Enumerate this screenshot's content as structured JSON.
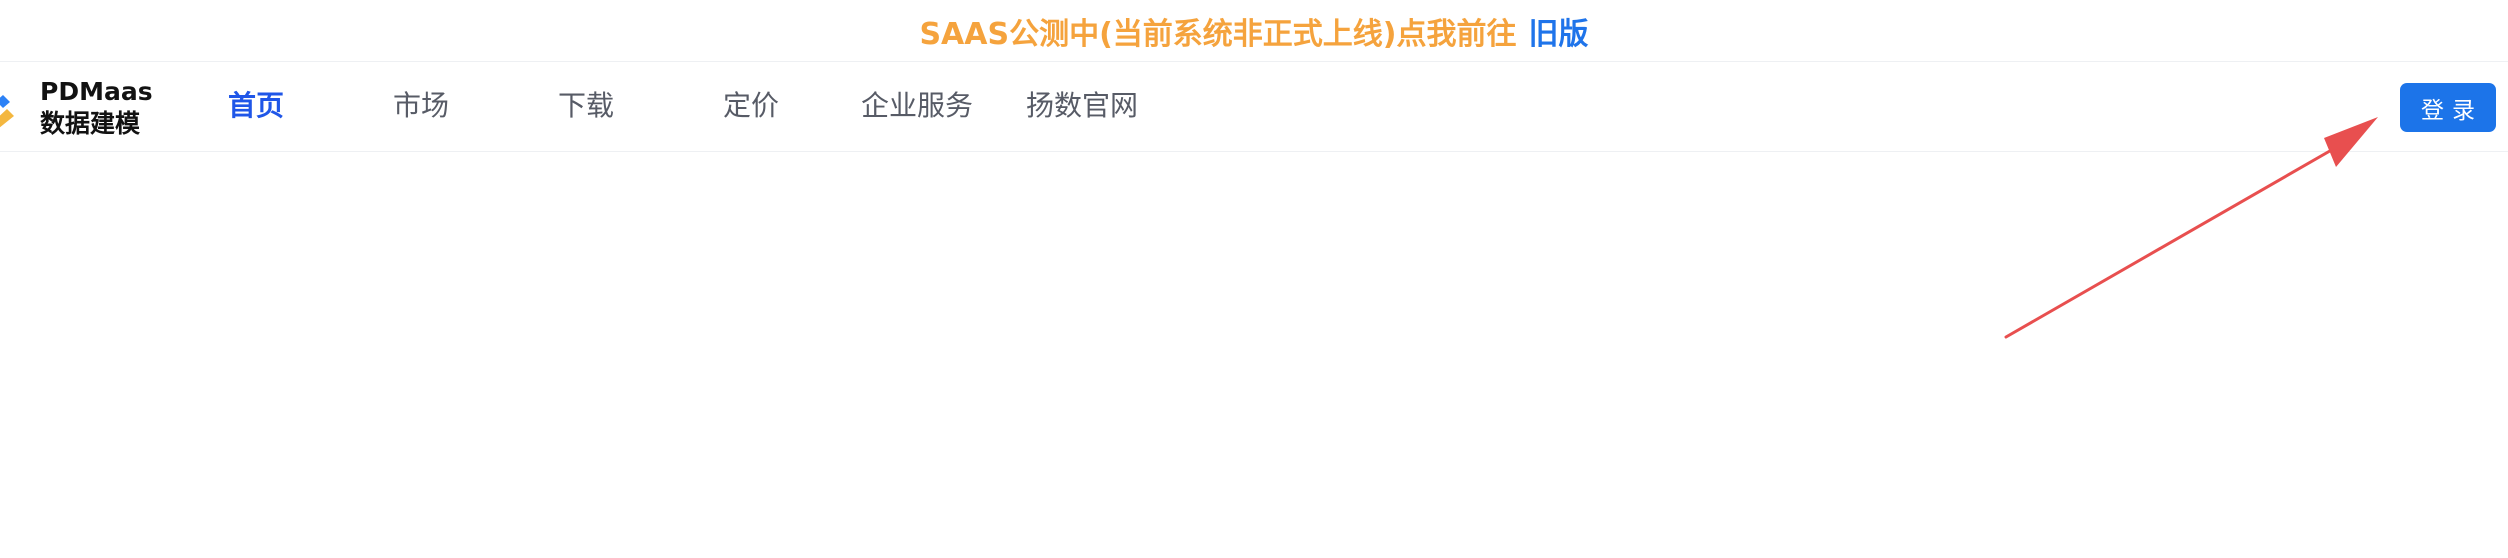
{
  "banner": {
    "text": "SAAS公测中(当前系统非正式上线)点我前往",
    "link_label": "旧版"
  },
  "logo": {
    "line1": "PDMaas",
    "line2": "数据建模"
  },
  "nav": {
    "items": [
      {
        "label": "首页",
        "active": true
      },
      {
        "label": "市场",
        "active": false
      },
      {
        "label": "下载",
        "active": false
      },
      {
        "label": "定价",
        "active": false
      },
      {
        "label": "企业服务",
        "active": false
      },
      {
        "label": "扬数官网",
        "active": false
      }
    ]
  },
  "login": {
    "label": "登录"
  },
  "colors": {
    "banner_text": "#f5a33d",
    "banner_link": "#1f74ea",
    "nav_active": "#1f56e8",
    "nav_text": "#575b66",
    "login_button": "#1c74e9",
    "annotation_arrow": "#e84f4f"
  },
  "icons": {
    "logo": "pdmaas-logo-icon",
    "annotation": "red-arrow-icon"
  }
}
